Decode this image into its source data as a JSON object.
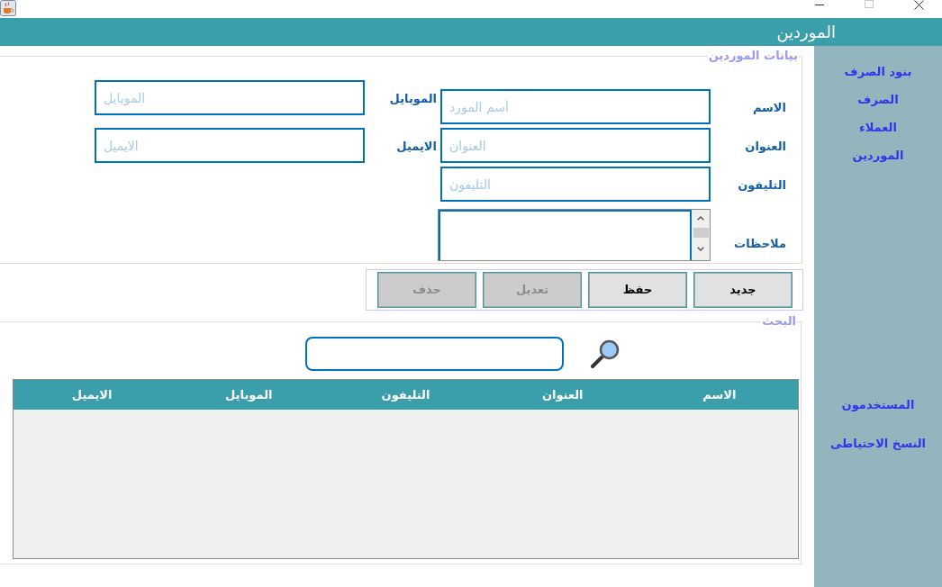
{
  "header": {
    "title": "الموردين"
  },
  "supplier_form": {
    "title": "بيانات الموردين",
    "columns": [
      {
        "fields": [
          {
            "kind": "text",
            "label": "الاسم",
            "placeholder": "أسم المورد"
          },
          {
            "kind": "text",
            "label": "العنوان",
            "placeholder": "العنوان"
          },
          {
            "kind": "text",
            "label": "التليفون",
            "placeholder": "التليفون"
          },
          {
            "kind": "textarea",
            "label": "ملاحظات"
          }
        ]
      },
      {
        "fields": [
          {
            "kind": "text",
            "label": "الموبايل",
            "placeholder": "الموبايل"
          },
          {
            "kind": "text",
            "label": "الايميل",
            "placeholder": "الايميل"
          }
        ]
      }
    ]
  },
  "buttons": [
    {
      "label": "جديد",
      "disabled": false
    },
    {
      "label": "حفظ",
      "disabled": false
    },
    {
      "label": "تعديل",
      "disabled": true
    },
    {
      "label": "حذف",
      "disabled": true
    }
  ],
  "search": {
    "title": "البحث"
  },
  "table": {
    "columns": [
      "الاسم",
      "العنوان",
      "التليفون",
      "الموبايل",
      "الايميل"
    ]
  },
  "sidebar": {
    "groups": [
      {
        "items": [
          {
            "label": "بنود الصرف"
          },
          {
            "label": "الصرف"
          },
          {
            "label": "العملاء"
          },
          {
            "label": "الموردين"
          }
        ]
      },
      {
        "items": [
          {
            "label": "المستخدمون"
          },
          {
            "label": "النسخ الاحتياطى"
          }
        ]
      }
    ]
  }
}
